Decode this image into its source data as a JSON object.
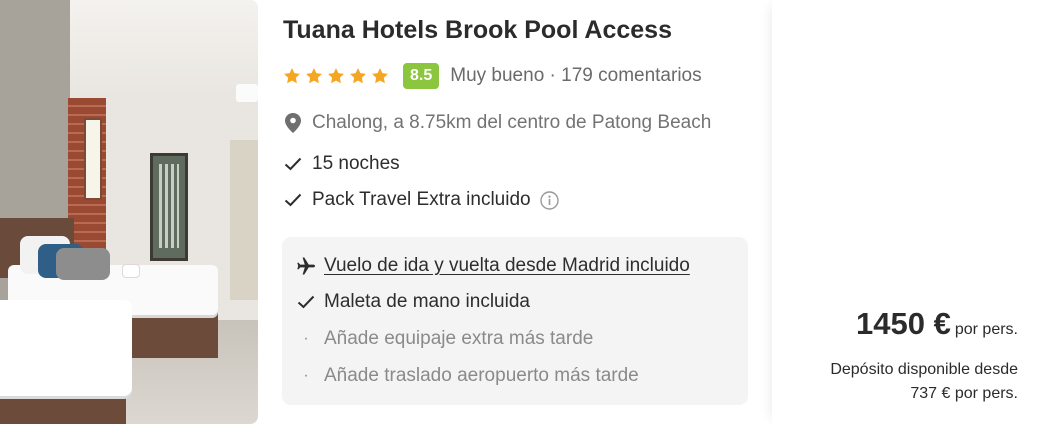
{
  "hotel": {
    "name": "Tuana Hotels Brook Pool Access",
    "stars": 5,
    "star_color": "#f5a623",
    "score": "8.5",
    "score_color": "#8cc63f",
    "rating_text": "Muy bueno · 179 comentarios",
    "location": "Chalong, a 8.75km del centro de Patong Beach",
    "nights": "15 noches",
    "pack": "Pack Travel Extra incluido"
  },
  "flight": {
    "link": "Vuelo de ida y vuelta desde Madrid incluido",
    "bag": "Maleta de mano incluida",
    "extra_luggage": "Añade equipaje extra más tarde",
    "transfer": "Añade traslado aeropuerto más tarde"
  },
  "pricing": {
    "price": "1450 €",
    "per_person": "por pers.",
    "deposit_label": "Depósito disponible desde",
    "deposit_value": "737 € por pers."
  },
  "icons": {
    "star": "star-icon",
    "location": "location-pin-icon",
    "check": "check-icon",
    "info": "info-icon",
    "plane": "plane-icon",
    "bullet": "·"
  }
}
